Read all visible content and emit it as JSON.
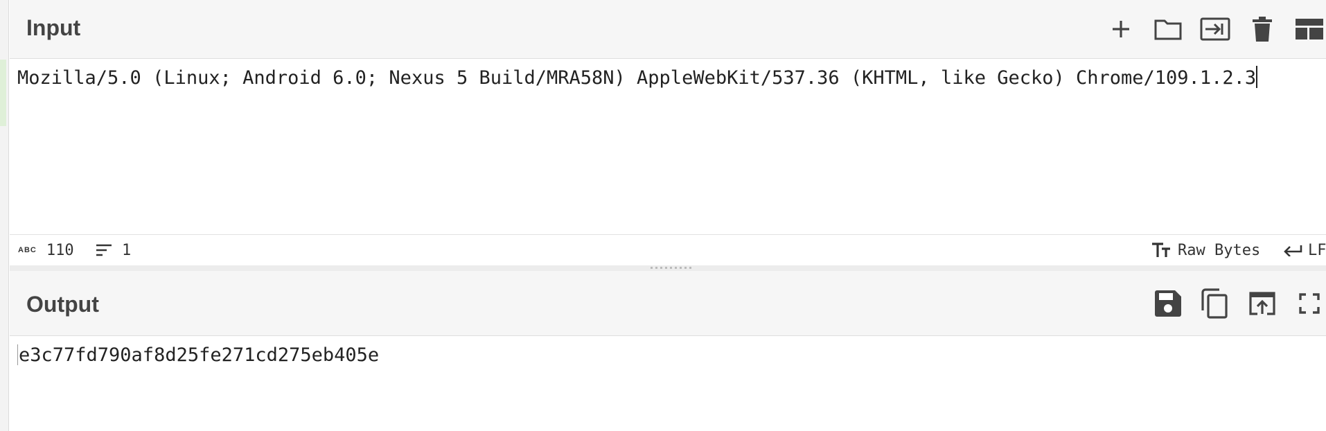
{
  "input_pane": {
    "title": "Input",
    "text": "Mozilla/5.0 (Linux; Android 6.0; Nexus 5 Build/MRA58N) AppleWebKit/537.36 (KHTML, like Gecko) Chrome/109.1.2.3",
    "toolbar_icons": [
      "plus-icon",
      "folder-icon",
      "import-icon",
      "trash-icon",
      "layout-icon"
    ]
  },
  "status_bar": {
    "char_icon": "ABC",
    "char_count": "110",
    "line_count": "1",
    "encoding": "Raw Bytes",
    "eol": "LF"
  },
  "output_pane": {
    "title": "Output",
    "text": "e3c77fd790af8d25fe271cd275eb405e",
    "toolbar_icons": [
      "save-icon",
      "copy-icon",
      "replace-input-icon",
      "maximize-icon"
    ]
  },
  "colors": {
    "header_bg": "#f6f6f6",
    "icon": "#444444",
    "highlight_green": "#dff0d8"
  }
}
